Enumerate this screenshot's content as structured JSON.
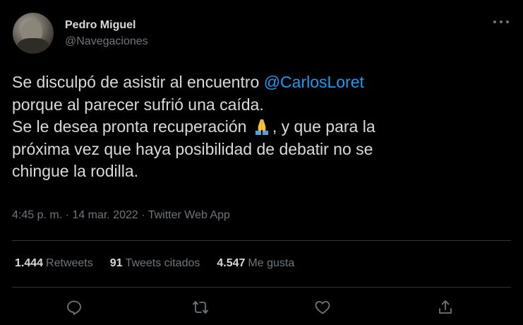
{
  "author": {
    "display_name": "Pedro Miguel",
    "handle": "@Navegaciones"
  },
  "tweet": {
    "line1_text": "Se disculpó de asistir al encuentro ",
    "mention": "@CarlosLoret",
    "line2": "porque al parecer sufrió una caída.",
    "line3_before_emoji": "Se le desea pronta recuperación ",
    "emoji": "folded-hands",
    "line3_after_emoji": ", y que para la",
    "line4": "próxima vez que haya posibilidad de debatir no se",
    "line5": "chingue la rodilla."
  },
  "meta": {
    "time": "4:45 p. m.",
    "separator1": " · ",
    "date": "14 mar. 2022",
    "separator2": " · ",
    "source": "Twitter Web App"
  },
  "stats": {
    "retweets_count": "1.444",
    "retweets_label": "Retweets",
    "quotes_count": "91",
    "quotes_label": "Tweets citados",
    "likes_count": "4.547",
    "likes_label": "Me gusta"
  },
  "actions": {
    "reply_icon": "reply-icon",
    "retweet_icon": "retweet-icon",
    "like_icon": "heart-icon",
    "share_icon": "share-icon"
  },
  "colors": {
    "background": "#000000",
    "text": "#d9d9d9",
    "secondary": "#6e767d",
    "link": "#1d9bf0",
    "divider": "#2f3336"
  }
}
